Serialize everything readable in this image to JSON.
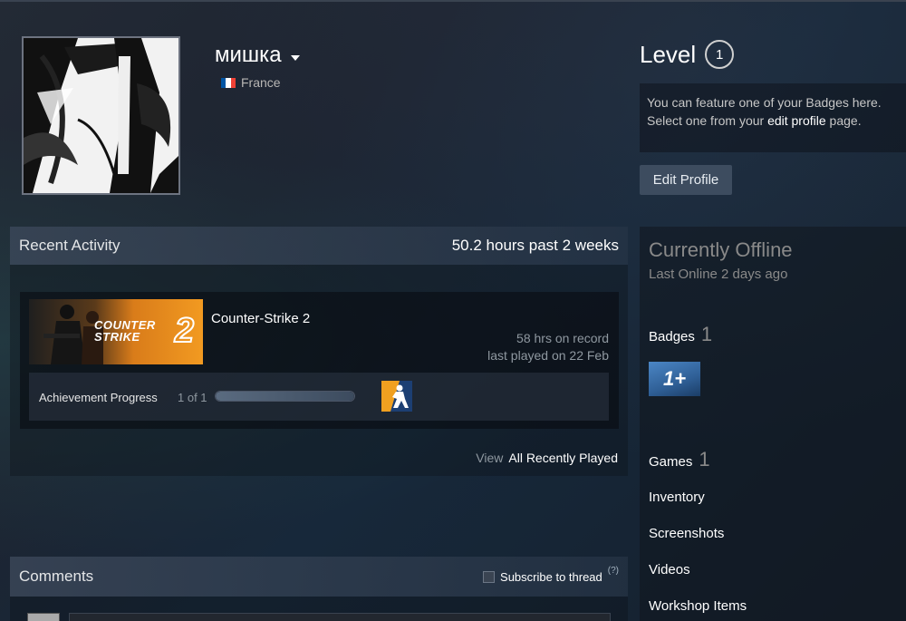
{
  "profile": {
    "persona_name": "мишка",
    "country": "France",
    "flag_colors": [
      "#0055A4",
      "#FFFFFF",
      "#EF4135"
    ]
  },
  "level": {
    "label": "Level",
    "value": "1"
  },
  "badge_note": {
    "line1": "You can feature one of your Badges here.",
    "line2_prefix": "Select one from your ",
    "line2_link": "edit profile",
    "line2_suffix": " page."
  },
  "edit_profile_label": "Edit Profile",
  "recent_activity": {
    "title": "Recent Activity",
    "hours_summary": "50.2 hours past 2 weeks",
    "game": {
      "name": "Counter-Strike 2",
      "capsule_title_line1": "COUNTER",
      "capsule_title_line2": "STRIKE",
      "capsule_number": "2",
      "hours_on_record": "58 hrs on record",
      "last_played": "last played on 22 Feb",
      "achievement_label": "Achievement Progress",
      "achievement_count": "1 of 1",
      "achievement_progress": 1.0
    },
    "view_label": "View",
    "view_link": "All Recently Played"
  },
  "comments": {
    "title": "Comments",
    "subscribe_label": "Subscribe to thread",
    "help_label": "(?)"
  },
  "sidebar": {
    "status": "Currently Offline",
    "last_online": "Last Online 2 days ago",
    "badges_label": "Badges",
    "badges_count": "1",
    "badge_text": "1+",
    "games_label": "Games",
    "games_count": "1",
    "inventory_label": "Inventory",
    "screenshots_label": "Screenshots",
    "videos_label": "Videos",
    "workshop_label": "Workshop Items"
  }
}
